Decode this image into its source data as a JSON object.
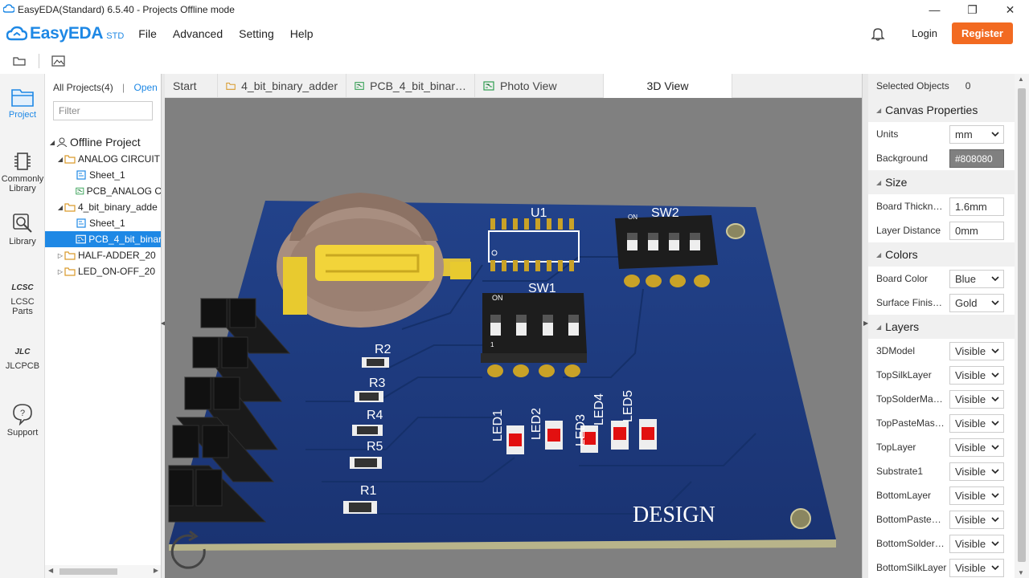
{
  "window": {
    "title": "EasyEDA(Standard) 6.5.40 - Projects Offline mode",
    "min": "—",
    "max": "❐",
    "close": "✕"
  },
  "menubar": {
    "brand": "EasyEDA",
    "edition": "STD",
    "items": [
      "File",
      "Advanced",
      "Setting",
      "Help"
    ],
    "login": "Login",
    "register": "Register"
  },
  "leftrail": {
    "items": [
      {
        "label": "Project"
      },
      {
        "label": "Commonly Library"
      },
      {
        "label": "Library"
      },
      {
        "label": "LCSC Parts",
        "logo": "LCSC"
      },
      {
        "label": "JLCPCB",
        "logo": "JLC"
      },
      {
        "label": "Support"
      }
    ]
  },
  "projects": {
    "all_label": "All Projects(4)",
    "separator": "|",
    "open_label": "Open",
    "filter_placeholder": "Filter",
    "tree": [
      {
        "label": "Offline Project"
      },
      {
        "label": "ANALOG CIRCUIT"
      },
      {
        "label": "Sheet_1"
      },
      {
        "label": "PCB_ANALOG C"
      },
      {
        "label": "4_bit_binary_adde"
      },
      {
        "label": "Sheet_1"
      },
      {
        "label": "PCB_4_bit_binar"
      },
      {
        "label": "HALF-ADDER_20"
      },
      {
        "label": "LED_ON-OFF_20"
      }
    ]
  },
  "tabs": [
    {
      "label": "Start"
    },
    {
      "label": "4_bit_binary_adder"
    },
    {
      "label": "PCB_4_bit_binar…"
    },
    {
      "label": "Photo View"
    },
    {
      "label": "3D View"
    }
  ],
  "board": {
    "designators": {
      "u1": "U1",
      "sw1": "SW1",
      "sw2": "SW2",
      "r1": "R1",
      "r2": "R2",
      "r3": "R3",
      "r4": "R4",
      "r5": "R5",
      "led1": "LED1",
      "led2": "LED2",
      "led3": "LED3",
      "led4": "LED4",
      "led5": "LED5"
    },
    "switch_on": "ON",
    "switch_one": "1",
    "design_text": "DESIGN",
    "board_color": "#1d3a7c",
    "background_color": "#808080"
  },
  "properties": {
    "selected_label": "Selected Objects",
    "selected_count": "0",
    "canvas_title": "Canvas Properties",
    "units_label": "Units",
    "units_value": "mm",
    "bg_label": "Background",
    "bg_value": "#808080",
    "size_title": "Size",
    "thick_label": "Board Thickn…",
    "thick_value": "1.6mm",
    "dist_label": "Layer Distance",
    "dist_value": "0mm",
    "colors_title": "Colors",
    "boardcolor_label": "Board Color",
    "boardcolor_value": "Blue",
    "finish_label": "Surface Finis…",
    "finish_value": "Gold",
    "layers_title": "Layers",
    "layers": [
      {
        "name": "3DModel",
        "value": "Visible"
      },
      {
        "name": "TopSilkLayer",
        "value": "Visible"
      },
      {
        "name": "TopSolderMa…",
        "value": "Visible"
      },
      {
        "name": "TopPasteMas…",
        "value": "Visible"
      },
      {
        "name": "TopLayer",
        "value": "Visible"
      },
      {
        "name": "Substrate1",
        "value": "Visible"
      },
      {
        "name": "BottomLayer",
        "value": "Visible"
      },
      {
        "name": "BottomPaste…",
        "value": "Visible"
      },
      {
        "name": "BottomSolder…",
        "value": "Visible"
      },
      {
        "name": "BottomSilkLayer",
        "value": "Visible"
      }
    ]
  }
}
